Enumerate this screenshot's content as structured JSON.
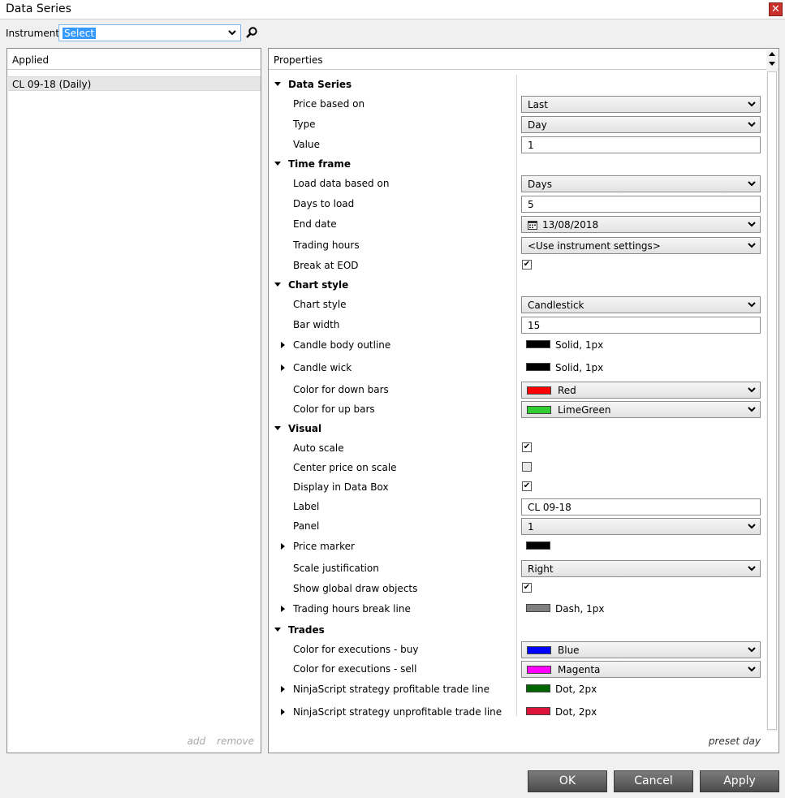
{
  "window": {
    "title": "Data Series"
  },
  "instrument": {
    "label": "Instrument",
    "value": "Select"
  },
  "applied": {
    "header": "Applied",
    "items": [
      "CL 09-18 (Daily)"
    ],
    "add_label": "add",
    "remove_label": "remove"
  },
  "properties": {
    "header": "Properties",
    "preset_label": "preset day",
    "rows": [
      {
        "kind": "category",
        "label": "Data Series"
      },
      {
        "kind": "dropdown",
        "label": "Price based on",
        "value": "Last"
      },
      {
        "kind": "dropdown",
        "label": "Type",
        "value": "Day"
      },
      {
        "kind": "input",
        "label": "Value",
        "value": "1"
      },
      {
        "kind": "category",
        "label": "Time frame"
      },
      {
        "kind": "dropdown",
        "label": "Load data based on",
        "value": "Days"
      },
      {
        "kind": "input",
        "label": "Days to load",
        "value": "5"
      },
      {
        "kind": "date",
        "label": "End date",
        "value": "13/08/2018",
        "icon": "calendar-icon"
      },
      {
        "kind": "dropdown",
        "label": "Trading hours",
        "value": "<Use instrument settings>"
      },
      {
        "kind": "checkbox",
        "label": "Break at EOD",
        "checked": true
      },
      {
        "kind": "category",
        "label": "Chart style"
      },
      {
        "kind": "dropdown",
        "label": "Chart style",
        "value": "Candlestick"
      },
      {
        "kind": "input",
        "label": "Bar width",
        "value": "15"
      },
      {
        "kind": "stroke",
        "label": "Candle body outline",
        "value": "Solid, 1px",
        "color": "#000000"
      },
      {
        "kind": "stroke",
        "label": "Candle wick",
        "value": "Solid, 1px",
        "color": "#000000"
      },
      {
        "kind": "colordrop",
        "label": "Color for down bars",
        "value": "Red",
        "color": "#ff0000"
      },
      {
        "kind": "colordrop",
        "label": "Color for up bars",
        "value": "LimeGreen",
        "color": "#32cd32"
      },
      {
        "kind": "category",
        "label": "Visual"
      },
      {
        "kind": "checkbox",
        "label": "Auto scale",
        "checked": true
      },
      {
        "kind": "checkbox",
        "label": "Center price on scale",
        "checked": false
      },
      {
        "kind": "checkbox",
        "label": "Display in Data Box",
        "checked": true
      },
      {
        "kind": "input",
        "label": "Label",
        "value": "CL 09-18"
      },
      {
        "kind": "dropdown",
        "label": "Panel",
        "value": "1"
      },
      {
        "kind": "stroke",
        "label": "Price marker",
        "value": "",
        "color": "#000000"
      },
      {
        "kind": "dropdown",
        "label": "Scale justification",
        "value": "Right"
      },
      {
        "kind": "checkbox",
        "label": "Show global draw objects",
        "checked": true
      },
      {
        "kind": "stroke",
        "label": "Trading hours break line",
        "value": "Dash, 1px",
        "color": "#808080"
      },
      {
        "kind": "category",
        "label": "Trades"
      },
      {
        "kind": "colordrop",
        "label": "Color for executions - buy",
        "value": "Blue",
        "color": "#0000ff"
      },
      {
        "kind": "colordrop",
        "label": "Color for executions - sell",
        "value": "Magenta",
        "color": "#ff00ff"
      },
      {
        "kind": "stroke",
        "label": "NinjaScript strategy profitable trade line",
        "value": "Dot, 2px",
        "color": "#006400"
      },
      {
        "kind": "stroke",
        "label": "NinjaScript strategy unprofitable trade line",
        "value": "Dot, 2px",
        "color": "#dc143c"
      }
    ]
  },
  "buttons": {
    "ok": "OK",
    "cancel": "Cancel",
    "apply": "Apply"
  }
}
